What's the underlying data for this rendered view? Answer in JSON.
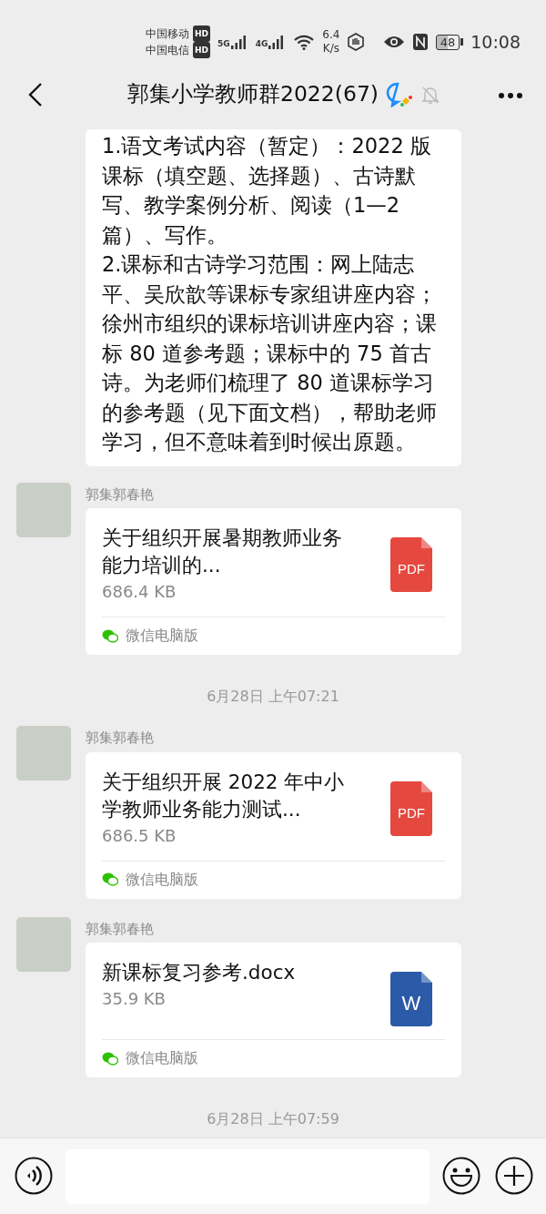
{
  "status_bar": {
    "carriers": [
      {
        "name": "中国移动",
        "badge": "HD"
      },
      {
        "name": "中国电信",
        "badge": "HD"
      }
    ],
    "networks": [
      "5G",
      "4G"
    ],
    "speed_value": "6.4",
    "speed_unit": "K/s",
    "battery": "48",
    "time": "10:08"
  },
  "header": {
    "title": "郭集小学教师群2022(67)"
  },
  "messages": [
    {
      "kind": "text",
      "text": "1.语文考试内容（暂定）：2022 版课标（填空题、选择题）、古诗默写、教学案例分析、阅读（1—2篇）、写作。\n2.课标和古诗学习范围：网上陆志平、吴欣歆等课标专家组讲座内容；徐州市组织的课标培训讲座内容；课标 80 道参考题；课标中的 75 首古诗。为老师们梳理了 80 道课标学习的参考题（见下面文档），帮助老师学习，但不意味着到时候出原题。"
    },
    {
      "kind": "file",
      "sender": "郭集郭春艳",
      "file_name": "关于组织开展暑期教师业务能力培训的...",
      "size": "686.4 KB",
      "icon": {
        "kind": "pdf",
        "label": "PDF"
      },
      "source": "微信电脑版"
    },
    {
      "kind": "time",
      "text": "6月28日 上午07:21"
    },
    {
      "kind": "file",
      "sender": "郭集郭春艳",
      "file_name": "关于组织开展 2022 年中小学教师业务能力测试...",
      "size": "686.5 KB",
      "icon": {
        "kind": "pdf",
        "label": "PDF"
      },
      "source": "微信电脑版"
    },
    {
      "kind": "file",
      "sender": "郭集郭春艳",
      "file_name": "新课标复习参考.docx",
      "size": "35.9 KB",
      "icon": {
        "kind": "word",
        "label": "W"
      },
      "source": "微信电脑版"
    },
    {
      "kind": "time",
      "text": "6月28日 上午07:59"
    }
  ]
}
